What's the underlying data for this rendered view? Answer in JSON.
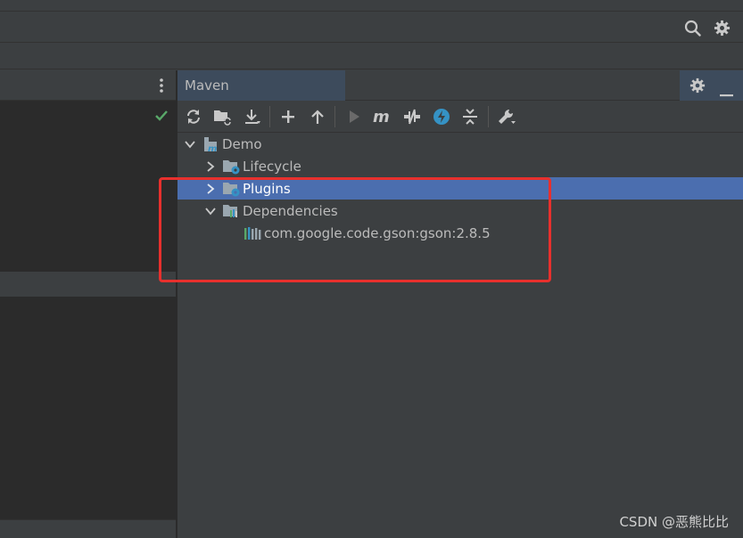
{
  "maven_panel": {
    "title": "Maven"
  },
  "tree": {
    "root": "Demo",
    "items": [
      {
        "label": "Lifecycle"
      },
      {
        "label": "Plugins"
      },
      {
        "label": "Dependencies"
      }
    ],
    "dependency": "com.google.code.gson:gson:2.8.5"
  },
  "watermark": "CSDN @恶熊比比",
  "colors": {
    "selection": "#4b6eaf",
    "highlight_box": "#e8302d",
    "panel_bg": "#3c3f41",
    "editor_bg": "#2b2b2b",
    "accent_blue": "#3592c4",
    "check_green": "#59a869"
  },
  "icons": [
    "search-icon",
    "gear-icon",
    "kebab-icon",
    "check-icon",
    "reload-icon",
    "add-folder-icon",
    "download-icon",
    "plus-icon",
    "arrow-up-icon",
    "run-icon",
    "maven-m-icon",
    "toggle-offline-icon",
    "skip-tests-icon",
    "collapse-icon",
    "wrench-icon",
    "minimize-icon",
    "chevron-down-icon",
    "chevron-right-icon",
    "module-icon",
    "folder-gear-icon",
    "library-icon"
  ]
}
